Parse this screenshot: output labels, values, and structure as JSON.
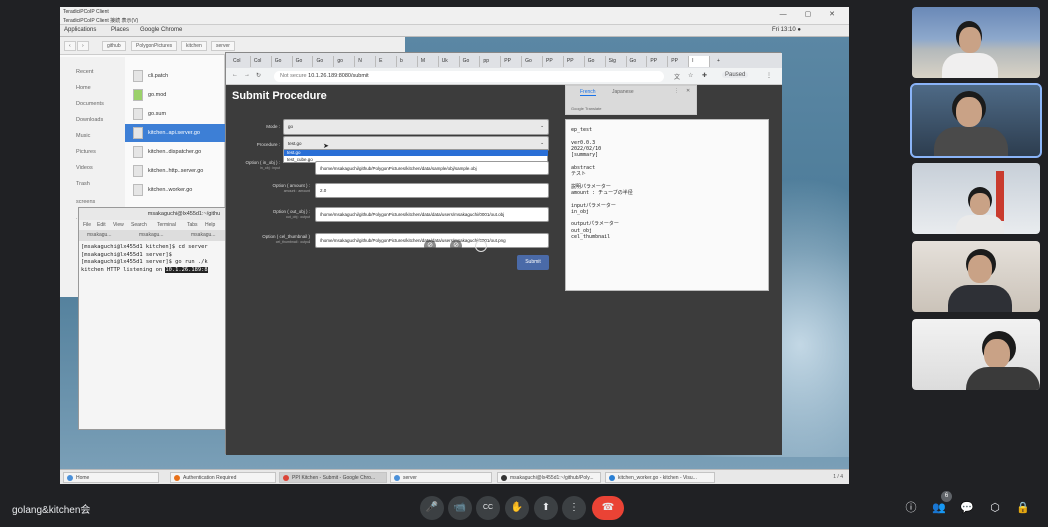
{
  "remote_desktop": {
    "title_line1": "TeradiciPCoIP Client",
    "title_line2": "TeradiciPCoIP Client   接続   表示(V)",
    "gnome_applications": "Applications",
    "gnome_places": "Places",
    "gnome_chrome": "Google Chrome",
    "clock": "Fri 13:10 ●"
  },
  "file_manager": {
    "crumbs": [
      "github",
      "PolygonPictures",
      "kitchen",
      "server"
    ],
    "sidebar": [
      "Recent",
      "Home",
      "Documents",
      "Downloads",
      "Music",
      "Pictures",
      "Videos",
      "Trash",
      "screens",
      "..."
    ],
    "files": [
      {
        "name": "cli.patch",
        "selected": false
      },
      {
        "name": "go.mod",
        "selected": false
      },
      {
        "name": "go.sum",
        "selected": false
      },
      {
        "name": "kitchen..api.server.go",
        "selected": true
      },
      {
        "name": "kitchen..dispatcher.go",
        "selected": false
      },
      {
        "name": "kitchen..http..server.go",
        "selected": false
      },
      {
        "name": "kitchen..worker.go",
        "selected": false
      }
    ]
  },
  "terminal": {
    "title": "msakaguchi@lx455d1:~/githu",
    "menu": [
      "File",
      "Edit",
      "View",
      "Search",
      "Terminal",
      "Tabs",
      "Help"
    ],
    "tabs": [
      "msakagu...",
      "msakagu...",
      "msakagu..."
    ],
    "line1": "[msakaguchi@lx455d1 kitchen]$ cd server",
    "line2": "[msakaguchi@lx455d1 server]$",
    "line3": "[msakaguchi@lx455d1 server]$ go run ./k",
    "line4": "kitchen HTTP listening on ",
    "line4_highlight": "10.1.26.189:8"
  },
  "chrome": {
    "tabs": [
      "Col",
      "Col",
      "Go",
      "Go",
      "Go",
      "go",
      "N",
      "E",
      "b",
      "M",
      "Uk",
      "Go",
      "pp",
      "PP",
      "Go",
      "PP",
      "PP",
      "Go",
      "Sig",
      "Go",
      "PP",
      "PP",
      "I"
    ],
    "url_security": "Not secure",
    "url": "10.1.26.189:8080/submit",
    "profile": "Paused",
    "page_title": "Submit Procedure",
    "mode_label": "Mode :",
    "mode_value": "go",
    "procedure_label": "Procedure :",
    "procedure_value": "test.go",
    "dropdown_options": [
      "test.go",
      "test_cube.go"
    ],
    "option1_label": "Option ( in_obj ) :",
    "option1_sub": "in_obj : input",
    "option1_value": "/home/msakaguchi/github/PolygonPictures/kitchen/data/sample/obj/sample.obj",
    "option2_label": "Option ( amount ) :",
    "option2_sub": "amount : amount",
    "option2_value": "2.0",
    "option3_label": "Option ( out_obj ) :",
    "option3_sub": "out_obj : output",
    "option3_value": "/home/msakaguchi/github/PolygonPictures/kitchen/data/data/users/msakaguchi/0001/out.obj",
    "option4_label": "Option ( cel_thumbnail ) :",
    "option4_sub": "cel_thumbnail : output",
    "option4_value": "/home/msakaguchi/github/PolygonPictures/kitchen/data/data/users/msakaguchi/0001/out.png",
    "submit_label": "Submit",
    "translate_tab1": "French",
    "translate_tab2": "Japanese",
    "translate_footer": "Google Translate",
    "side_text": "ep_test\n\nver0.0.3\n2022/02/10\n[summary]\n\nabstract\nテスト\n\n説明パラメーター\namount : チューブの半径\n\ninputパラメーター\nin_obj\n\noutputパラメーター\nout_obj\ncel_thumbnail"
  },
  "taskbar": {
    "items": [
      "Home",
      "Authentication Required",
      "PPI Kitchen - Submit - Google Chro...",
      "server",
      "msakaguchi@lx455d1:~/github/Poly...",
      "kitchen_worker.go - kitchen - Visu..."
    ],
    "page": "1 / 4"
  },
  "meeting": {
    "name": "golang&kitchen会",
    "participant_count": "6",
    "controls": {
      "mic": "🎤",
      "camera": "📹",
      "cc": "CC",
      "hand": "✋",
      "present": "⬆",
      "more": "⋮",
      "end": "☎"
    },
    "right": {
      "info": "ⓘ",
      "people": "👥",
      "chat": "💬",
      "activities": "⬡",
      "lock": "🔒"
    }
  }
}
